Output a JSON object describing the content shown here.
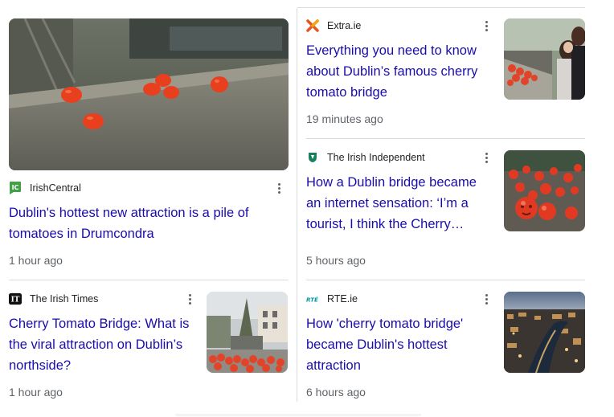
{
  "cards": [
    {
      "source": "IrishCentral",
      "title": "Dublin's hottest new attraction is a pile of tomatoes in Drumcondra",
      "time": "1 hour ago",
      "icon": "irishcentral-logo-icon",
      "icon_text": "IC",
      "icon_color": "#43a047"
    },
    {
      "source": "Extra.ie",
      "title": "Everything you need to know about Dublin’s famous cherry tomato bridge",
      "time": "19 minutes ago",
      "icon": "extra-ie-logo-icon",
      "icon_color": "#e8541b"
    },
    {
      "source": "The Irish Independent",
      "title": "How a Dublin bridge became an internet sensation: ‘I’m a tourist, I think the Cherry…",
      "time": "5 hours ago",
      "icon": "irish-independent-logo-icon",
      "icon_color": "#1b7f5c"
    },
    {
      "source": "The Irish Times",
      "title": "Cherry Tomato Bridge: What is the viral attraction on Dublin’s northside?",
      "time": "1 hour ago",
      "icon": "irish-times-logo-icon",
      "icon_text": "IT",
      "icon_color": "#111111"
    },
    {
      "source": "RTE.ie",
      "title": "How 'cherry tomato bridge' became Dublin's hottest attraction",
      "time": "6 hours ago",
      "icon": "rte-logo-icon",
      "icon_text": "RTÉ",
      "icon_color": "#0097a7"
    }
  ],
  "colors": {
    "link": "#1a0dab",
    "meta": "#5f6368",
    "divider": "#dadce0"
  }
}
